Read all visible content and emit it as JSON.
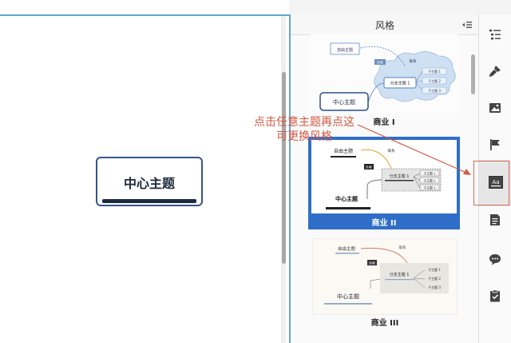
{
  "canvas": {
    "central_topic": "中心主题"
  },
  "style_panel": {
    "title": "风格",
    "collapse_icon": "list-collapse-icon",
    "themes": [
      {
        "name": "商业 I",
        "preview": {
          "free_topic": "自由主题",
          "link_label": "联系",
          "tag_label": "外框",
          "branch_topic": "分支主题 1",
          "sub_topics": [
            "子主题 1",
            "子主题 2",
            "子主题 3"
          ],
          "central_topic": "中心主题"
        }
      },
      {
        "name": "商业 II",
        "selected": true,
        "preview": {
          "free_topic": "自由主题",
          "link_label": "联系",
          "tag_label": "外框",
          "branch_topic": "分支主题 1",
          "sub_topics": [
            "子主题 1",
            "子主题 2",
            "子主题 3"
          ],
          "central_topic": "中心主题"
        }
      },
      {
        "name": "商业 III",
        "preview": {
          "free_topic": "自由主题",
          "link_label": "联系",
          "tag_label": "外框",
          "branch_topic": "分支主题 1",
          "sub_topics": [
            "子主题 1",
            "子主题 2",
            "子主题 3"
          ],
          "central_topic": "中心主题"
        }
      }
    ]
  },
  "annotation": {
    "line1": "点击任意主题再点这",
    "line2": "可更换风格",
    "color": "#d25a44"
  },
  "toolbar": {
    "tools": [
      "outline-icon",
      "brush-icon",
      "image-icon",
      "flag-icon",
      "format-icon",
      "notes-icon",
      "comment-icon",
      "task-icon"
    ],
    "active_tool": "format-icon"
  },
  "colors": {
    "accent": "#2f6ec8",
    "divider": "#5fa8d3",
    "central_border": "#34568b",
    "highlight": "#d76b56"
  }
}
